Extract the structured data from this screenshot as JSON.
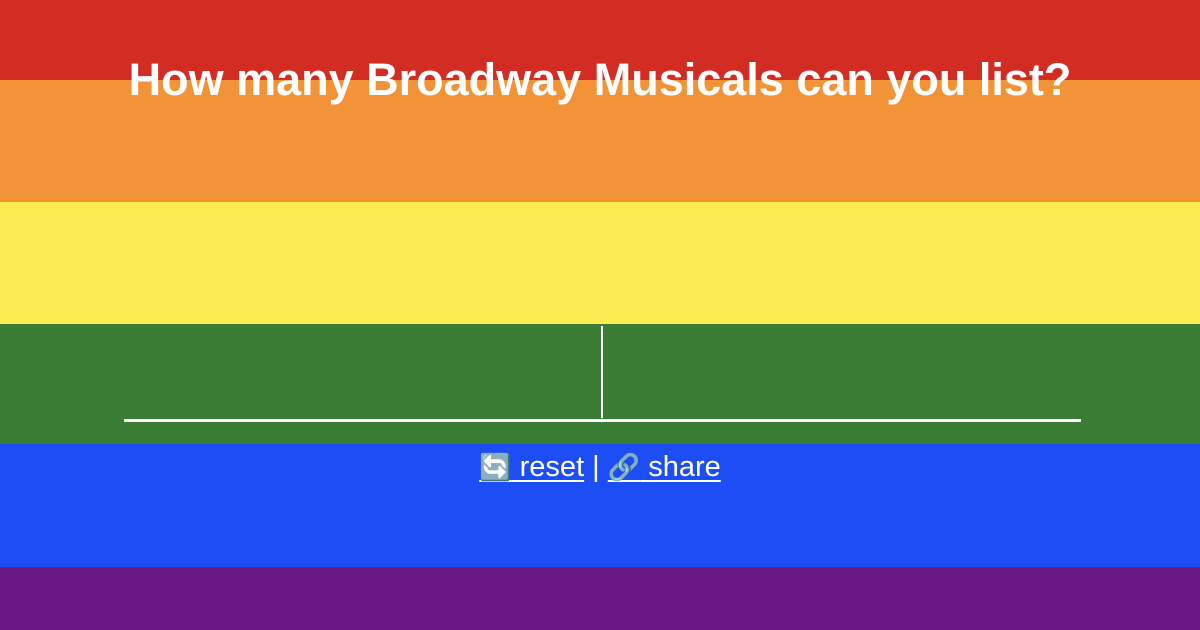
{
  "quiz": {
    "title": "How many Broadway Musicals can you list?",
    "answer_value": "",
    "answer_placeholder": ""
  },
  "actions": {
    "reset_icon": "🔄",
    "reset_label": " reset",
    "separator": " | ",
    "share_icon": "🔗",
    "share_label": " share"
  },
  "theme": {
    "stripe_colors": [
      "#d32c23",
      "#f19336",
      "#fcec51",
      "#3a7d34",
      "#1d4ef5",
      "#6b1884"
    ],
    "text_color": "#ffffff"
  }
}
